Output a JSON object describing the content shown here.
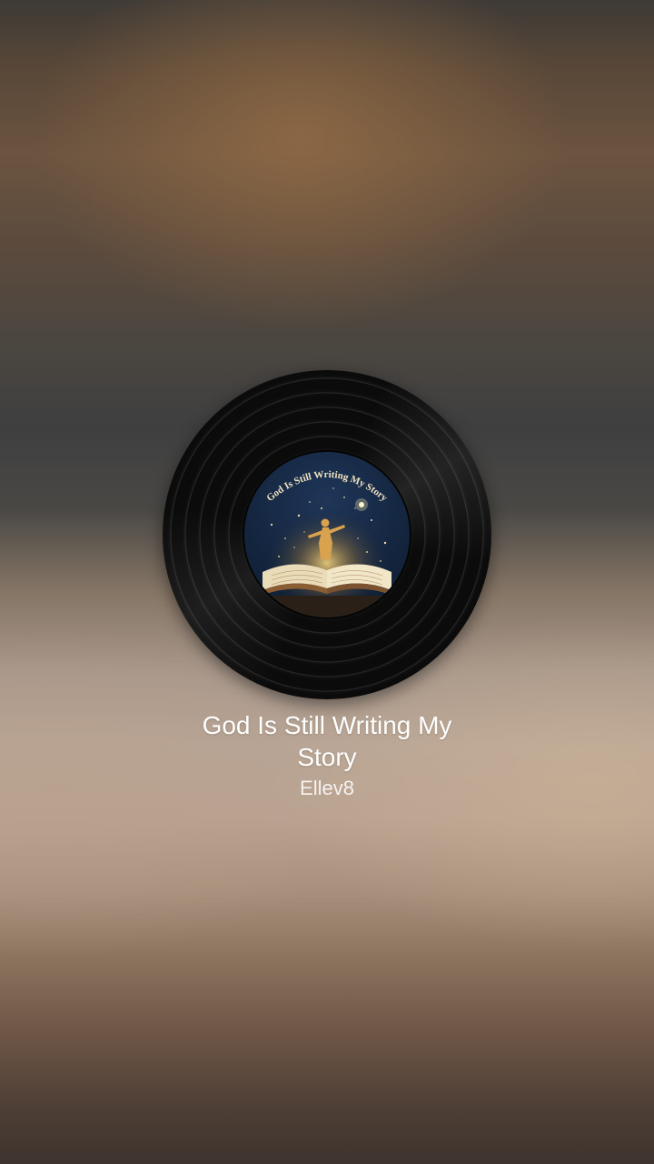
{
  "track": {
    "title": "God Is Still Writing My Story",
    "artist": "Ellev8"
  },
  "artwork": {
    "label_text": "God Is Still Writing My Story",
    "icon": "album-art-open-book-with-figure"
  },
  "colors": {
    "text": "#ffffff",
    "vinyl": "#0b0b0b",
    "label_sky": "#142640",
    "gold": "#d9b063"
  }
}
